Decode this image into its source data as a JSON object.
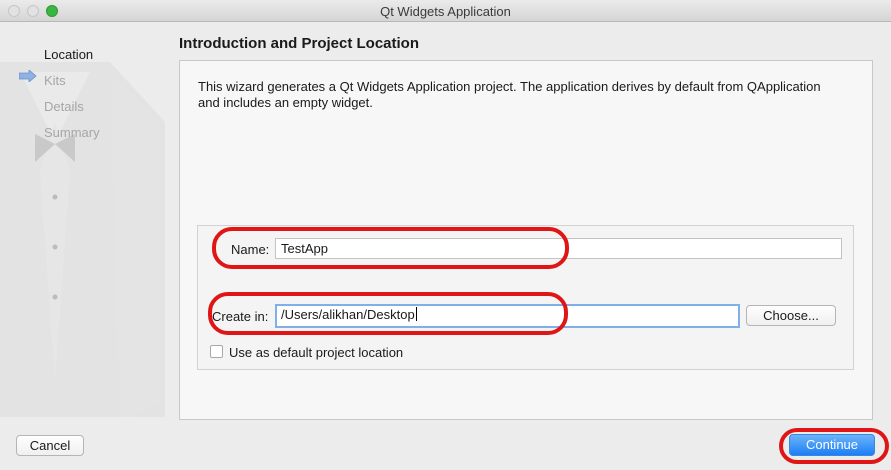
{
  "window": {
    "title": "Qt Widgets Application"
  },
  "sidebar": {
    "steps": [
      {
        "label": "Location",
        "active": true
      },
      {
        "label": "Kits",
        "active": false
      },
      {
        "label": "Details",
        "active": false
      },
      {
        "label": "Summary",
        "active": false
      }
    ]
  },
  "page": {
    "title": "Introduction and Project Location",
    "description": "This wizard generates a Qt Widgets Application project. The application derives by default from QApplication and includes an empty widget."
  },
  "form": {
    "name_label": "Name:",
    "name_value": "TestApp",
    "create_in_label": "Create in:",
    "create_in_value": "/Users/alikhan/Desktop",
    "choose_label": "Choose...",
    "default_location_label": "Use as default project location",
    "default_location_checked": false
  },
  "footer": {
    "cancel_label": "Cancel",
    "continue_label": "Continue"
  },
  "colors": {
    "annotation": "#e01515",
    "primary_button": "#1c7ff5",
    "focus_ring": "#7fb0ea"
  }
}
